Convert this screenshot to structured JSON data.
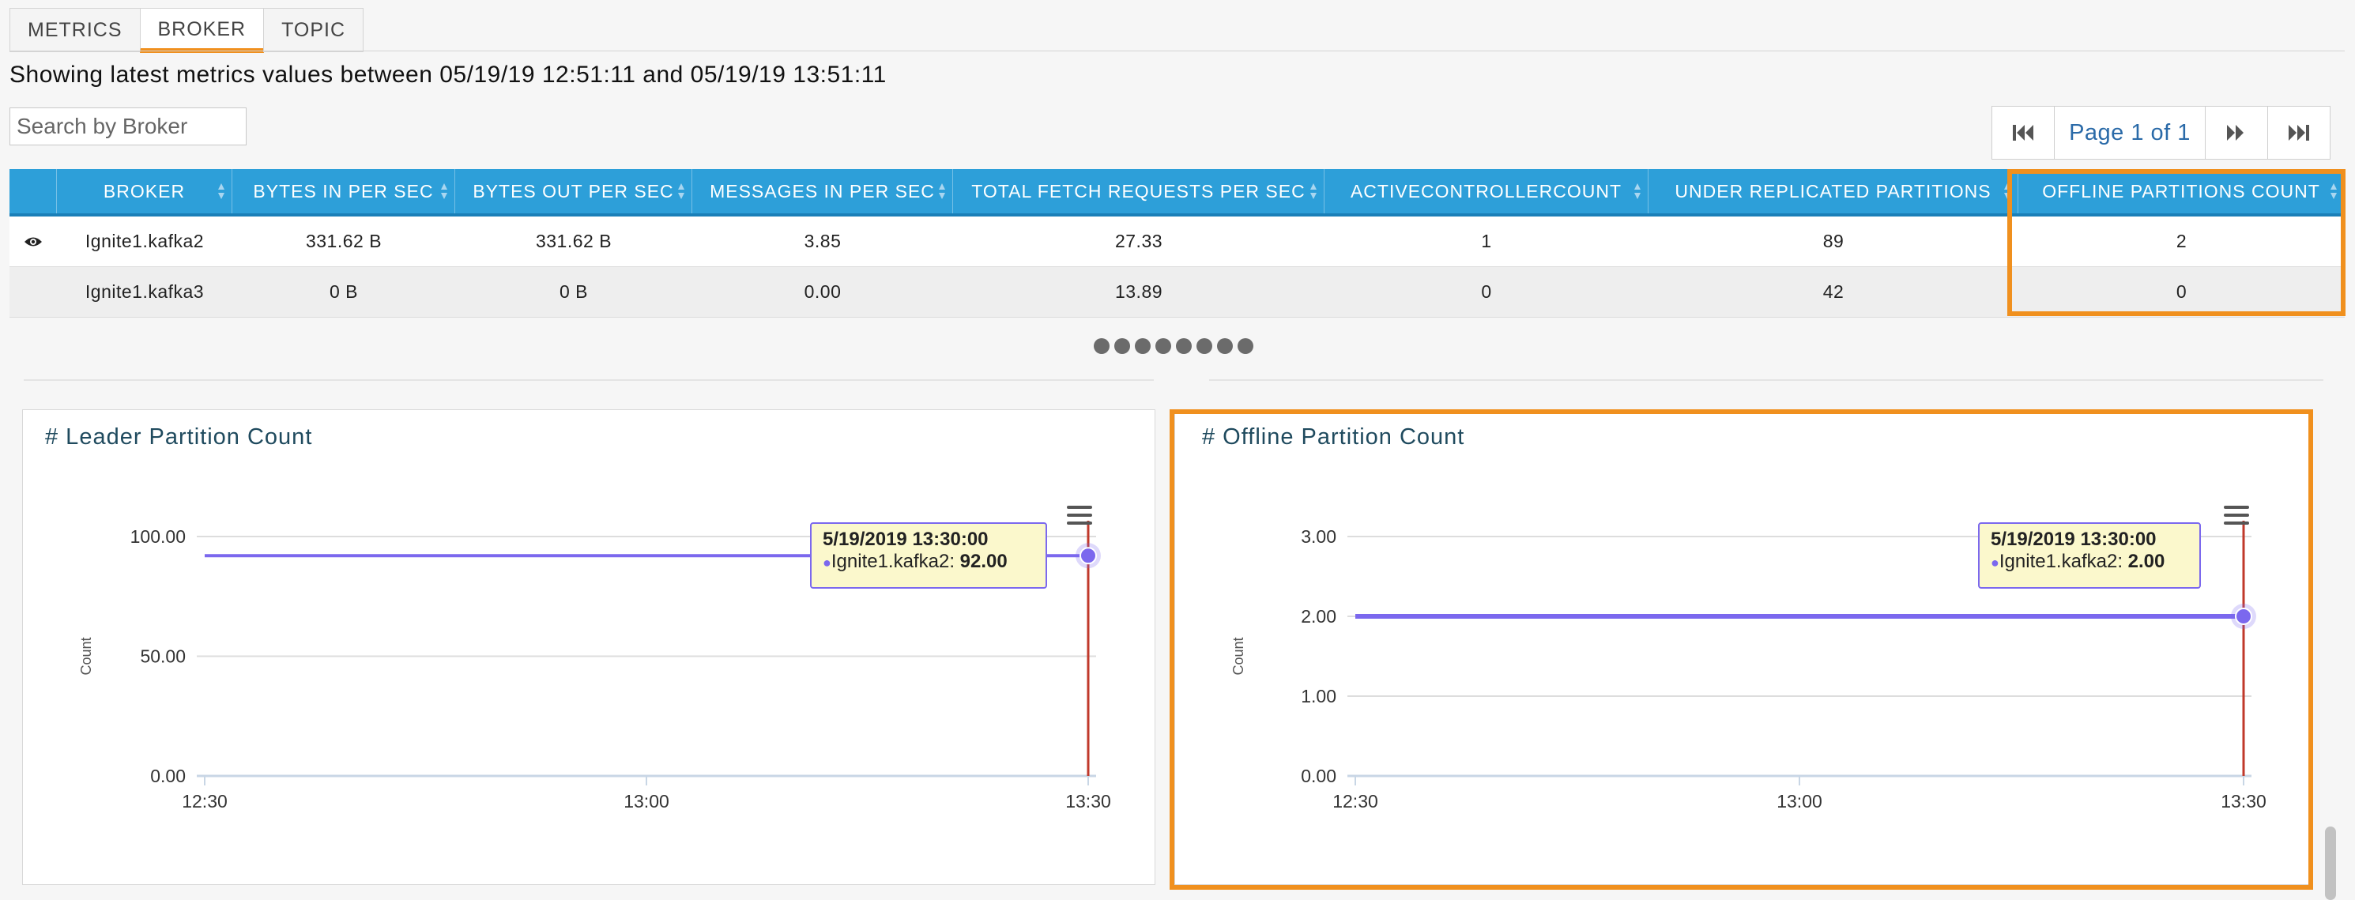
{
  "tabs": [
    {
      "label": "METRICS"
    },
    {
      "label": "BROKER"
    },
    {
      "label": "TOPIC"
    }
  ],
  "range_text": "Showing latest metrics values between 05/19/19 12:51:11 and 05/19/19 13:51:11",
  "search": {
    "placeholder": "Search by Broker"
  },
  "pagination": {
    "label": "Page 1 of 1"
  },
  "table": {
    "columns": [
      "",
      "BROKER",
      "BYTES IN PER SEC",
      "BYTES OUT PER SEC",
      "MESSAGES IN PER SEC",
      "TOTAL FETCH REQUESTS PER SEC",
      "ACTIVECONTROLLERCOUNT",
      "UNDER REPLICATED PARTITIONS",
      "OFFLINE PARTITIONS COUNT"
    ],
    "rows": [
      [
        "",
        "Ignite1.kafka2",
        "331.62 B",
        "331.62 B",
        "3.85",
        "27.33",
        "1",
        "89",
        "2"
      ],
      [
        "",
        "Ignite1.kafka3",
        "0 B",
        "0 B",
        "0.00",
        "13.89",
        "0",
        "42",
        "0"
      ]
    ]
  },
  "charts": [
    {
      "title": "# Leader Partition Count",
      "tooltip": {
        "date": "5/19/2019 13:30:00",
        "series": "Ignite1.kafka2:",
        "value": "92.00"
      }
    },
    {
      "title": "# Offline Partition Count",
      "tooltip": {
        "date": "5/19/2019 13:30:00",
        "series": "Ignite1.kafka2:",
        "value": "2.00"
      }
    }
  ],
  "chart_data": [
    {
      "type": "line",
      "title": "# Leader Partition Count",
      "ylabel": "Count",
      "xlabel": "",
      "x_ticks": [
        "12:30",
        "13:00",
        "13:30"
      ],
      "y_ticks": [
        "0.00",
        "50.00",
        "100.00"
      ],
      "ylim": [
        0,
        100
      ],
      "xlim": [
        "12:30",
        "13:30"
      ],
      "series": [
        {
          "name": "Ignite1.kafka2",
          "x": [
            "12:30",
            "13:30"
          ],
          "values": [
            92,
            92
          ]
        }
      ],
      "grid": true,
      "line_color": "#7b68ee",
      "marker_line_color": "#c0392b"
    },
    {
      "type": "line",
      "title": "# Offline Partition Count",
      "ylabel": "Count",
      "xlabel": "",
      "x_ticks": [
        "12:30",
        "13:00",
        "13:30"
      ],
      "y_ticks": [
        "0.00",
        "1.00",
        "2.00",
        "3.00"
      ],
      "ylim": [
        0,
        3
      ],
      "xlim": [
        "12:30",
        "13:30"
      ],
      "series": [
        {
          "name": "Ignite1.kafka2",
          "x": [
            "12:30",
            "13:30"
          ],
          "values": [
            2,
            2
          ]
        }
      ],
      "grid": true,
      "line_color": "#7b68ee",
      "marker_line_color": "#c0392b"
    }
  ],
  "colors": {
    "accent": "#f0901e",
    "header": "#2d9fd9",
    "link": "#2a6aa8"
  },
  "icons": {
    "first": "first-page-icon",
    "prev": "previous-page-icon",
    "next": "next-page-icon",
    "last": "last-page-icon",
    "eye": "eye-icon",
    "menu": "hamburger-menu-icon",
    "sort": "sort-icon"
  }
}
